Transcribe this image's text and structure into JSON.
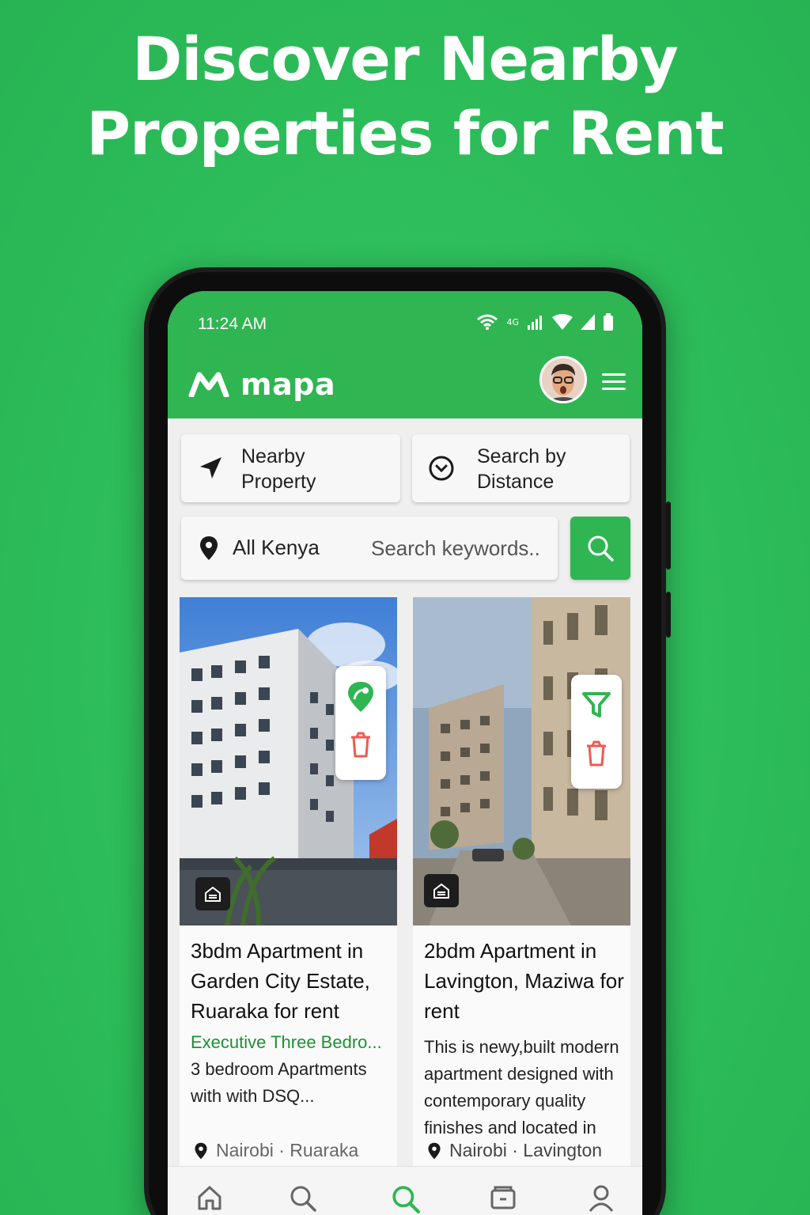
{
  "headline": {
    "line1": "Discover Nearby",
    "line2": "Properties for Rent"
  },
  "status_bar": {
    "time": "11:24 AM",
    "network_label": "4G",
    "icons": [
      "wifi-icon",
      "cell-signal-icon",
      "wifi-icon",
      "cell-signal-icon",
      "battery-icon"
    ]
  },
  "app": {
    "name": "mapa",
    "logo_icon": "mapa-m-logo",
    "avatar": "user-avatar",
    "menu_icon": "hamburger-menu-icon"
  },
  "colors": {
    "brand_green": "#2fb552",
    "background_green": "#2fbf5c",
    "subtitle_green": "#1f8f36",
    "delete_red": "#f05a4e"
  },
  "quick_actions": {
    "nearby_line1": "Nearby",
    "nearby_line2": "Property",
    "nearby_icon": "navigation-arrow-icon",
    "distance_line1": "Search by",
    "distance_line2": "Distance",
    "distance_icon": "chevron-circle-icon"
  },
  "search": {
    "location": "All Kenya",
    "location_icon": "location-pin-icon",
    "keyword_value": "",
    "keyword_placeholder": "Search keywords..",
    "button_icon": "search-icon"
  },
  "listings": [
    {
      "title": "3bdm Apartment in Garden City Estate, Ruaraka for rent",
      "subtitle": "Executive Three Bedro...",
      "description": "3 bedroom Apartments with with DSQ...",
      "location": "Nairobi · Ruaraka",
      "action_icons": [
        "map-pin-icon",
        "delete-icon"
      ],
      "type_icon": "property-type-icon"
    },
    {
      "title": "2bdm Apartment in Lavington, Maziwa for rent",
      "subtitle": "",
      "description": "This is newy,built modern apartment designed with contemporary quality finishes and located in",
      "location": "Nairobi · Lavington",
      "action_icons": [
        "filter-icon",
        "delete-icon"
      ],
      "type_icon": "property-type-icon"
    }
  ],
  "bottom_nav": {
    "items": [
      "home-icon",
      "search-icon",
      "search-icon",
      "listings-icon",
      "profile-icon"
    ],
    "active_index": 2
  }
}
